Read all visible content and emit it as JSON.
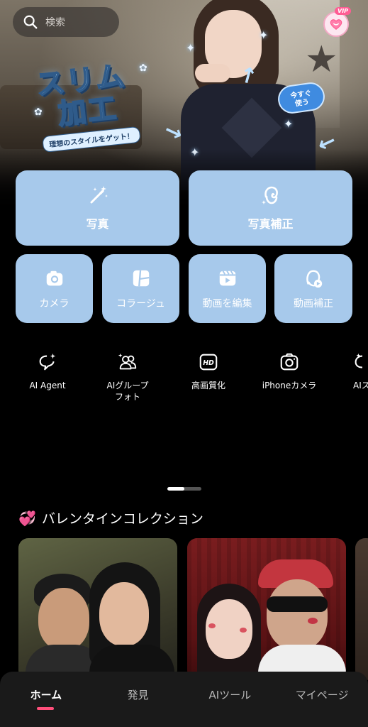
{
  "search": {
    "placeholder": "検索"
  },
  "vip": {
    "label": "VIP"
  },
  "hero": {
    "title_line1": "スリム",
    "title_line2": "加工",
    "tagline": "理想のスタイルをゲット！",
    "badge": "今すぐ\n使う"
  },
  "main_tiles": [
    {
      "label": "写真",
      "icon": "magic-wand-icon"
    },
    {
      "label": "写真補正",
      "icon": "retouch-face-icon"
    }
  ],
  "small_tiles": [
    {
      "label": "カメラ",
      "icon": "camera-icon"
    },
    {
      "label": "コラージュ",
      "icon": "collage-icon"
    },
    {
      "label": "動画を編集",
      "icon": "video-edit-icon"
    },
    {
      "label": "動画補正",
      "icon": "video-retouch-icon"
    }
  ],
  "tools": [
    {
      "label": "AI Agent",
      "icon": "ai-agent-icon"
    },
    {
      "label": "AIグループ\nフォト",
      "icon": "ai-group-photo-icon"
    },
    {
      "label": "高画質化",
      "icon": "hd-icon"
    },
    {
      "label": "iPhoneカメラ",
      "icon": "iphone-camera-icon"
    },
    {
      "label": "AIス",
      "icon": "ai-more-icon"
    }
  ],
  "pager": {
    "active": 1,
    "count": 2
  },
  "section": {
    "title": "バレンタインコレクション",
    "icon": "hearts-icon"
  },
  "bottom_nav": [
    {
      "label": "ホーム",
      "active": true
    },
    {
      "label": "発見",
      "active": false
    },
    {
      "label": "AIツール",
      "active": false
    },
    {
      "label": "マイページ",
      "active": false
    }
  ],
  "colors": {
    "tile": "#a7c9eb",
    "active_indicator": "#ff4f7b",
    "background": "#000000"
  }
}
